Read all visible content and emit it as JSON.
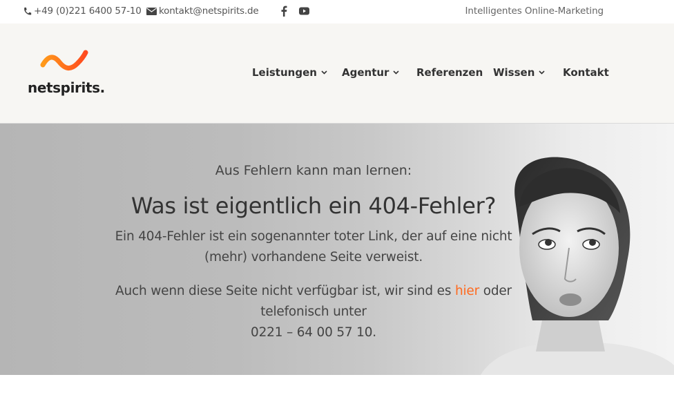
{
  "topbar": {
    "phone": "+49 (0)221 6400 57-10",
    "email": "kontakt@netspirits.de",
    "tagline": "Intelligentes Online-Marketing",
    "social": [
      "facebook-icon",
      "youtube-icon"
    ]
  },
  "header": {
    "logo_text": "netspirits.",
    "nav": [
      {
        "label": "Leistungen",
        "has_dropdown": true
      },
      {
        "label": "Agentur",
        "has_dropdown": true
      },
      {
        "label": "Referenzen",
        "has_dropdown": false
      },
      {
        "label": "Wissen",
        "has_dropdown": true
      },
      {
        "label": "Kontakt",
        "has_dropdown": false
      }
    ]
  },
  "hero": {
    "kicker": "Aus Fehlern kann man lernen:",
    "title": "Was ist eigentlich ein 404-Fehler?",
    "paragraph1": "Ein 404-Fehler ist ein sogenannter toter Link, der auf eine nicht (mehr) vorhandene Seite verweist.",
    "paragraph2_before": "Auch wenn diese Seite nicht verfügbar ist, wir sind es ",
    "paragraph2_link": "hier",
    "paragraph2_after": " oder telefonisch unter",
    "paragraph2_phone": "0221 – 64 00 57 10."
  },
  "colors": {
    "accent": "#ff6a1f",
    "logo_gradient_start": "#ff9a1a",
    "logo_gradient_end": "#ff4a1f",
    "header_bg": "#f7f6f3"
  }
}
